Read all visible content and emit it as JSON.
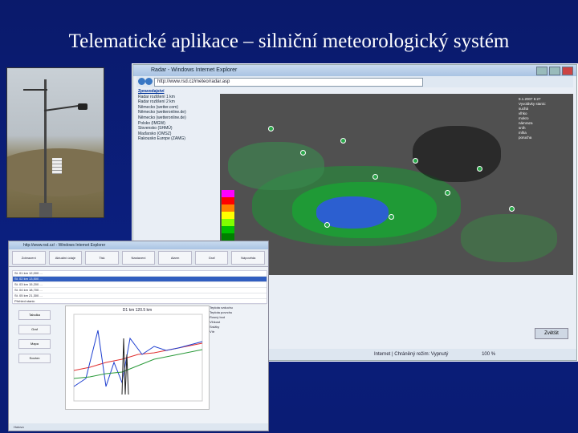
{
  "slide": {
    "title": "Telematické aplikace – silniční meteorologický systém"
  },
  "radar_window": {
    "title": "Radar - Windows Internet Explorer",
    "url": "http://www.rsd.cz/meteo/radar.asp",
    "menu_head": "Zpravodajství",
    "menu_items": [
      "Radar rozlišení 1 km",
      "Radar rozlišení 2 km",
      "Německo (wetter.com)",
      "Německo (wetteronline.de)",
      "Německo (wetteronline.de)",
      "Polsko (IMGW)",
      "Slovensko (SHMÚ)",
      "Maďarsko (OMSZ)",
      "Rakousko Europe (ZAMG)"
    ],
    "legend_time": "9.1.2007 5:27",
    "legend_title": "Vyvolávky stanic:",
    "legend_items": [
      "suchá",
      "vlhko",
      "mokro",
      "námraza",
      "sníh",
      "mlha",
      "porucha"
    ],
    "scale_label": "Vyvolávky stanic",
    "status": "Internet | Chráněný režim: Vypnutý",
    "zoom": "100 %",
    "zoom_button": "Zvětšit"
  },
  "station_window": {
    "title": "http://www.rsd.cz/ - Windows Internet Explorer",
    "toolbar": [
      "Zobrazení",
      "Aktuální údaje",
      "Tisk",
      "Nastavení",
      "Alarm",
      "Graf",
      "Nápověda"
    ],
    "rows": [
      "St. 01 km 12,000 ...",
      "St. 02 km 13,500 ...",
      "St. 03 km 15,200 ...",
      "St. 04 km 18,700 ...",
      "St. 05 km 21,300 ...",
      "Přehled stanic"
    ],
    "side_buttons": [
      "Tabulka",
      "Graf",
      "Mapa",
      "Souhrn"
    ],
    "chart_title": "D1 km 120.5 km",
    "legend_items": [
      "Teplota vzduchu",
      "Teplota povrchu",
      "Rosný bod",
      "Vlhkost",
      "Srážky",
      "Vítr"
    ],
    "status": "Hotovo"
  }
}
